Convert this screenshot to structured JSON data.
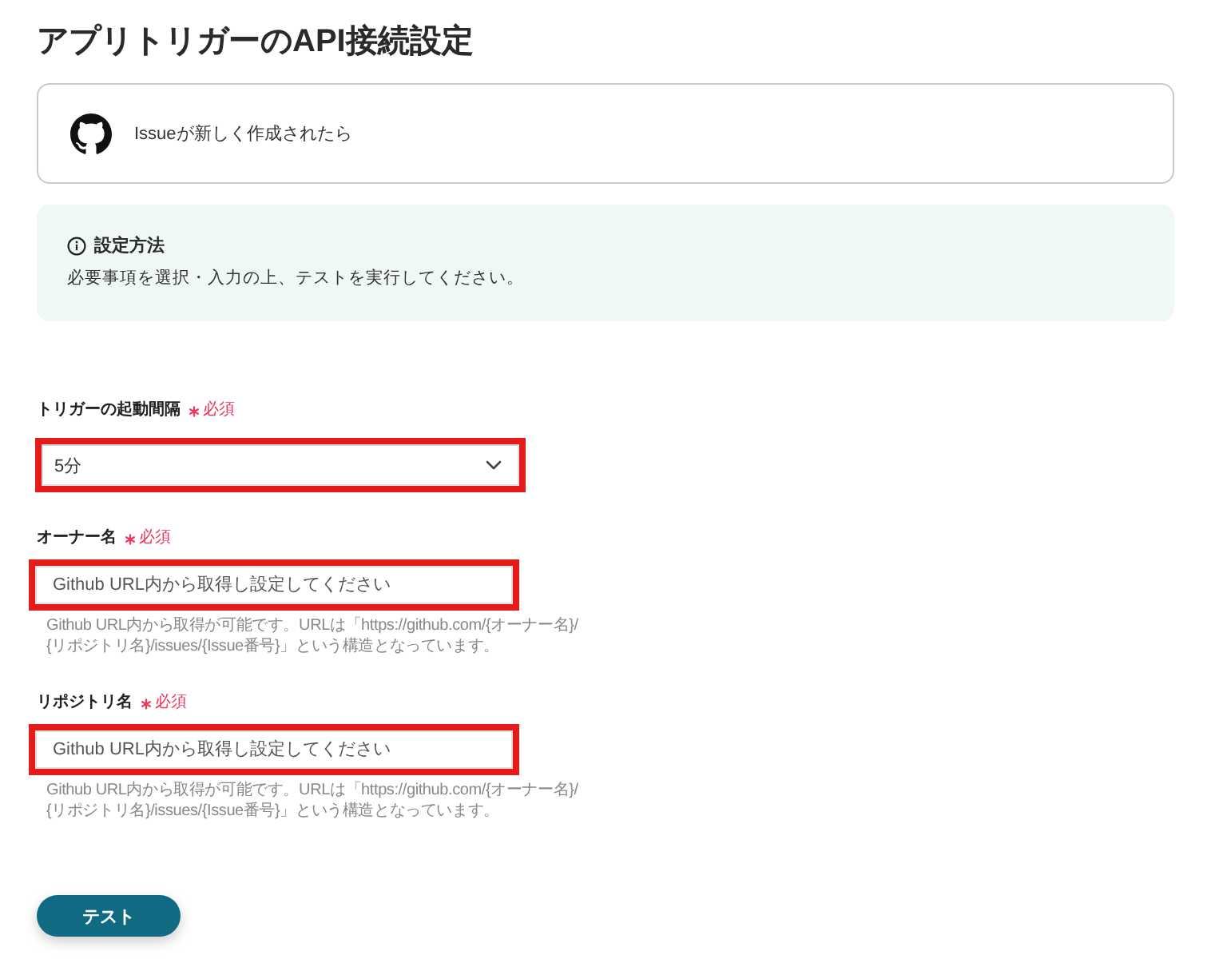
{
  "page": {
    "title": "アプリトリガーのAPI接続設定"
  },
  "trigger_card": {
    "text": "Issueが新しく作成されたら"
  },
  "info_box": {
    "heading": "設定方法",
    "text": "必要事項を選択・入力の上、テストを実行してください。"
  },
  "fields": [
    {
      "kind": "select",
      "label": "トリガーの起動間隔",
      "required_label": "必須",
      "value": "5分",
      "highlighted": true
    },
    {
      "kind": "text",
      "label": "オーナー名",
      "required_label": "必須",
      "placeholder": "Github URL内から取得し設定してください",
      "help": "Github URL内から取得が可能です。URLは「https://github.com/{オーナー名}/{リポジトリ名}/issues/{Issue番号}」という構造となっています。",
      "highlighted": true
    },
    {
      "kind": "text",
      "label": "リポジトリ名",
      "required_label": "必須",
      "placeholder": "Github URL内から取得し設定してください",
      "help": "Github URL内から取得が可能です。URLは「https://github.com/{オーナー名}/{リポジトリ名}/issues/{Issue番号}」という構造となっています。",
      "highlighted": true
    }
  ],
  "buttons": [
    {
      "label": "テスト"
    }
  ]
}
